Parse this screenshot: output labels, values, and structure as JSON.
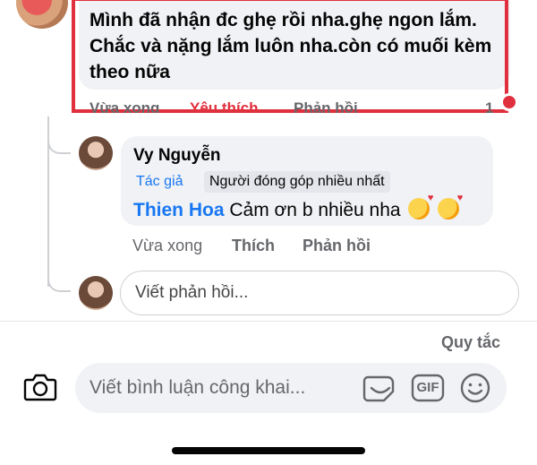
{
  "top_comment": {
    "text": "Mình đã nhận đc ghẹ rồi nha.ghẹ ngon lắm. Chắc và nặng lắm luôn nha.còn có muối kèm theo nữa",
    "time": "Vừa xong",
    "like_label": "Yêu thích",
    "reply_label": "Phản hồi",
    "reaction_count": "1"
  },
  "reply": {
    "author": "Vy Nguyễn",
    "badges": [
      "Tác giả",
      "Người đóng góp nhiều nhất"
    ],
    "mention": "Thien Hoa",
    "text": "Cảm ơn b nhiều nha",
    "time": "Vừa xong",
    "like_label": "Thích",
    "reply_label": "Phản hồi"
  },
  "reply_input": {
    "placeholder": "Viết phản hồi..."
  },
  "rules_link": "Quy tắc",
  "composer": {
    "placeholder": "Viết bình luận công khai...",
    "gif_label": "GIF"
  },
  "colors": {
    "accent": "#1877f2",
    "highlight": "#e0303d",
    "bubble": "#f0f2f5",
    "muted": "#65676b"
  },
  "icons": [
    "camera-icon",
    "sticker-icon",
    "gif-icon",
    "emoji-icon",
    "heart-reaction-icon"
  ]
}
